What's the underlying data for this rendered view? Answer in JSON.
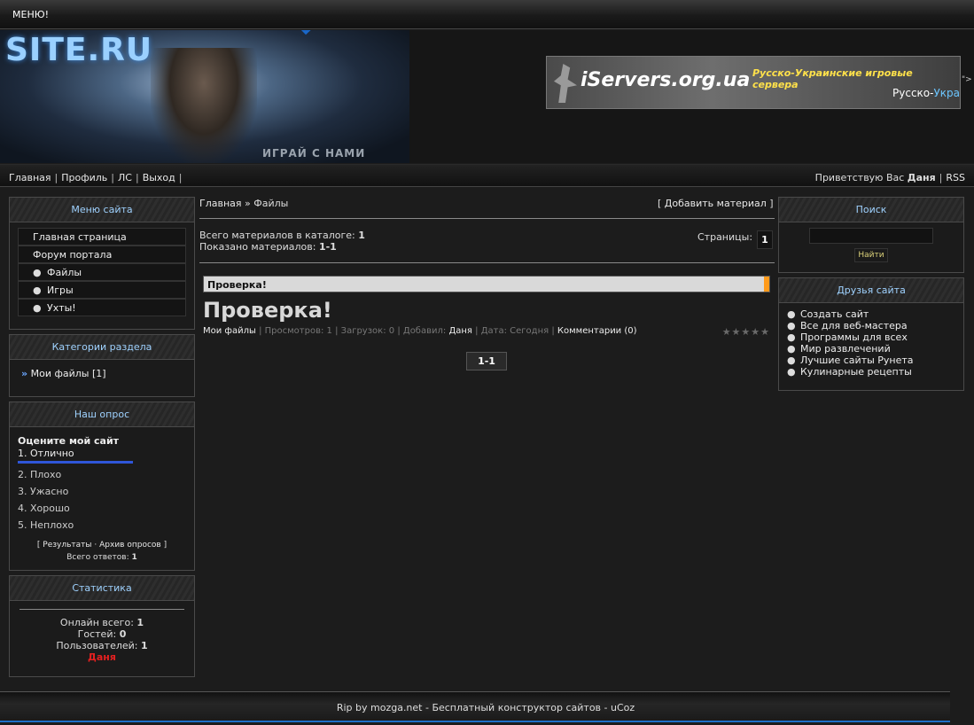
{
  "topbar": {
    "menu_label": "МЕНЮ!"
  },
  "header": {
    "logo": "SITE.RU",
    "slogan": "ИГРАЙ С НАМИ",
    "ad": {
      "logo": "iServers.org.ua",
      "tagline": "Русско-Украинские игровые сервера",
      "sub_prefix": "Русско-",
      "sub_suffix": "Укра",
      "arrow": "\">"
    }
  },
  "nav": {
    "left_items": [
      "Главная",
      "Профиль",
      "ЛС",
      "Выход"
    ],
    "greeting": "Приветствую Вас",
    "username": "Даня",
    "rss": "RSS"
  },
  "left": {
    "site_menu": {
      "title": "Меню сайта",
      "items": [
        {
          "label": "Главная страница"
        },
        {
          "label": "Форум портала"
        },
        {
          "label": "Файлы"
        },
        {
          "label": "Игры"
        },
        {
          "label": "Ухты!"
        }
      ]
    },
    "categories": {
      "title": "Категории раздела",
      "item_label": "Мои файлы",
      "item_count": "[1]"
    },
    "poll": {
      "title": "Наш опрос",
      "question": "Оцените мой сайт",
      "options": [
        "1. Отлично",
        "2. Плохо",
        "3. Ужасно",
        "4. Хорошо",
        "5. Неплохо"
      ],
      "results_link": "Результаты",
      "archive_link": "Архив опросов",
      "total_label": "Всего ответов:",
      "total_value": "1"
    },
    "stats": {
      "title": "Статистика",
      "online_label": "Онлайн всего:",
      "online_value": "1",
      "guests_label": "Гостей:",
      "guests_value": "0",
      "users_label": "Пользователей:",
      "users_value": "1",
      "user_name": "Даня"
    }
  },
  "center": {
    "breadcrumb_home": "Главная",
    "breadcrumb_sep": "»",
    "breadcrumb_current": "Файлы",
    "add_material": "Добавить материал",
    "total_label": "Всего материалов в каталоге:",
    "total_value": "1",
    "shown_label": "Показано материалов:",
    "shown_value": "1-1",
    "pages_label": "Страницы:",
    "page_current": "1",
    "entry": {
      "header_title": "Проверка!",
      "title": "Проверка!",
      "category": "Мои файлы",
      "views_label": "Просмотров:",
      "views_value": "1",
      "downloads_label": "Загрузок:",
      "downloads_value": "0",
      "added_label": "Добавил:",
      "added_by": "Даня",
      "date_label": "Дата:",
      "date_value": "Сегодня",
      "comments": "Комментарии (0)",
      "rating_stars": "★★★★★"
    },
    "pager": "1-1"
  },
  "right": {
    "search": {
      "title": "Поиск",
      "input_value": "",
      "button": "Найти"
    },
    "friends": {
      "title": "Друзья сайта",
      "items": [
        "Создать сайт",
        "Все для веб-мастера",
        "Программы для всех",
        "Мир развлечений",
        "Лучшие сайты Рунета",
        "Кулинарные рецепты"
      ]
    }
  },
  "footer": {
    "text": "Rip by mozga.net - Бесплатный конструктор сайтов - uCoz"
  }
}
